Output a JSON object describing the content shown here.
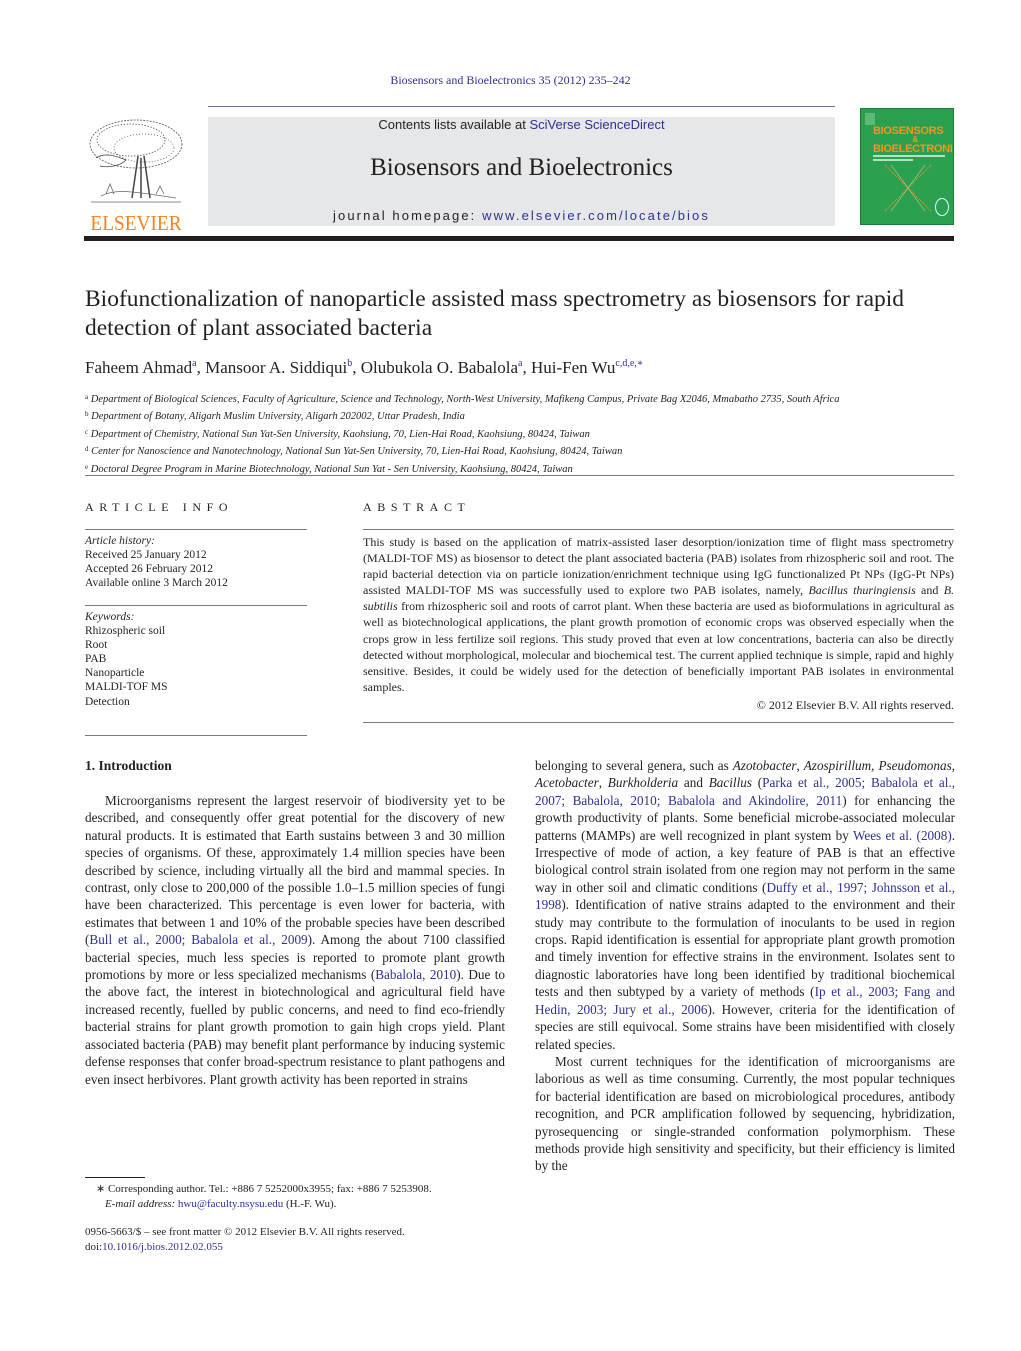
{
  "header": {
    "citation": "Biosensors and Bioelectronics 35 (2012) 235–242",
    "publisher_logo_text": "ELSEVIER",
    "contents_prefix": "Contents lists available at ",
    "contents_link": "SciVerse ScienceDirect",
    "journal_title": "Biosensors and Bioelectronics",
    "homepage_prefix": "journal homepage: ",
    "homepage_link": "www.elsevier.com/locate/bios",
    "cover_title_line1": "BIOSENSORS",
    "cover_title_amp": "&",
    "cover_title_line2": "BIOELECTRONICS"
  },
  "article": {
    "title": "Biofunctionalization of nanoparticle assisted mass spectrometry as biosensors for rapid detection of plant associated bacteria",
    "authors": [
      {
        "name": "Faheem Ahmad",
        "sup": "a"
      },
      {
        "name": "Mansoor A. Siddiqui",
        "sup": "b"
      },
      {
        "name": "Olubukola O. Babalola",
        "sup": "a"
      },
      {
        "name": "Hui-Fen Wu",
        "sup": "c,d,e,∗"
      }
    ],
    "affiliations": [
      {
        "sup": "a",
        "text": "Department of Biological Sciences, Faculty of Agriculture, Science and Technology, North-West University, Mafikeng Campus, Private Bag X2046, Mmabatho 2735, South Africa"
      },
      {
        "sup": "b",
        "text": "Department of Botany, Aligarh Muslim University, Aligarh 202002, Uttar Pradesh, India"
      },
      {
        "sup": "c",
        "text": "Department of Chemistry, National Sun Yat-Sen University, Kaohsiung, 70, Lien-Hai Road, Kaohsiung, 80424, Taiwan"
      },
      {
        "sup": "d",
        "text": "Center for Nanoscience and Nanotechnology, National Sun Yat-Sen University, 70, Lien-Hai Road, Kaohsiung, 80424, Taiwan"
      },
      {
        "sup": "e",
        "text": "Doctoral Degree Program in Marine Biotechnology, National Sun Yat - Sen University, Kaohsiung, 80424, Taiwan"
      }
    ]
  },
  "article_info": {
    "heading": "ARTICLE INFO",
    "history_label": "Article history:",
    "history": [
      "Received 25 January 2012",
      "Accepted 26 February 2012",
      "Available online 3 March 2012"
    ],
    "keywords_label": "Keywords:",
    "keywords": [
      "Rhizospheric soil",
      "Root",
      "PAB",
      "Nanoparticle",
      "MALDI-TOF MS",
      "Detection"
    ]
  },
  "abstract": {
    "heading": "ABSTRACT",
    "p1": "This study is based on the application of matrix-assisted laser desorption/ionization time of flight mass spectrometry (MALDI-TOF MS) as biosensor to detect the plant associated bacteria (PAB) isolates from rhizospheric soil and root. The rapid bacterial detection via on particle ionization/enrichment technique using IgG functionalized Pt NPs (IgG-Pt NPs) assisted MALDI-TOF MS was successfully used to explore two PAB isolates, namely, ",
    "sp1": "Bacillus thuringiensis",
    "and": " and ",
    "sp2": "B. subtilis",
    "p2": " from rhizospheric soil and roots of carrot plant. When these bacteria are used as bioformulations in agricultural as well as biotechnological applications, the plant growth promotion of economic crops was observed especially when the crops grow in less fertilize soil regions. This study proved that even at low concentrations, bacteria can also be directly detected without morphological, molecular and biochemical test. The current applied technique is simple, rapid and highly sensitive. Besides, it could be widely used for the detection of beneficially important PAB isolates in environmental samples.",
    "copyright": "© 2012 Elsevier B.V. All rights reserved."
  },
  "introduction": {
    "heading": "1.  Introduction",
    "c1_a": "Microorganisms represent the largest reservoir of biodiversity yet to be described, and consequently offer great potential for the discovery of new natural products. It is estimated that Earth sustains between 3 and 30 million species of organisms. Of these, approximately 1.4 million species have been described by science, including virtually all the bird and mammal species. In contrast, only close to 200,000 of the possible 1.0–1.5 million species of fungi have been characterized. This percentage is even lower for bacteria, with estimates that between 1 and 10% of the probable species have been described (",
    "ref1": "Bull et al., 2000; Babalola et al., 2009",
    "c1_b": "). Among the about 7100 classified bacterial species, much less species is reported to promote plant growth promotions by more or less specialized mechanisms (",
    "ref2": "Babalola, 2010",
    "c1_c": "). Due to the above fact, the interest in biotechnological and agricultural field have increased recently, fuelled by public concerns, and need to find eco-friendly bacterial strains for plant growth promotion to gain high crops yield. Plant associated bacteria (PAB) may benefit plant performance by inducing systemic defense responses that confer broad-spectrum resistance to plant pathogens and even insect herbivores. Plant growth activity has been reported in strains",
    "c2_a": "belonging to several genera, such as ",
    "g1": "Azotobacter",
    "g2": "Azospirillum",
    "g3": "Pseudomonas",
    "g4": "Acetobacter",
    "g5": "Burkholderia",
    "g6": "Bacillus",
    "ref3": "Parka et al., 2005; Babalola et al., 2007; Babalola, 2010; Babalola and Akindolire, 2011",
    "c2_b": ") for enhancing the growth productivity of plants. Some beneficial microbe-associated molecular patterns (MAMPs) are well recognized in plant system by ",
    "ref4": "Wees et al. (2008)",
    "c2_c": ". Irrespective of mode of action, a key feature of PAB is that an effective biological control strain isolated from one region may not perform in the same way in other soil and climatic conditions (",
    "ref5": "Duffy et al., 1997; Johnsson et al., 1998",
    "c2_d": "). Identification of native strains adapted to the environment and their study may contribute to the formulation of inoculants to be used in region crops. Rapid identification is essential for appropriate plant growth promotion and timely invention for effective strains in the environment. Isolates sent to diagnostic laboratories have long been identified by traditional biochemical tests and then subtyped by a variety of methods (",
    "ref6": "Ip et al., 2003; Fang and Hedin, 2003; Jury et al., 2006",
    "c2_e": "). However, criteria for the identification of species are still equivocal. Some strains have been misidentified with closely related species.",
    "c2_p2": "Most current techniques for the identification of microorganisms are laborious as well as time consuming. Currently, the most popular techniques for bacterial identification are based on microbiological procedures, antibody recognition, and PCR amplification followed by sequencing, hybridization, pyrosequencing or single-stranded conformation polymorphism. These methods provide high sensitivity and specificity, but their efficiency is limited by the"
  },
  "footnote": {
    "star": "∗",
    "corresponding": "Corresponding author. Tel.: +886 7 5252000x3955; fax: +886 7 5253908.",
    "email_label": "E-mail address: ",
    "email": "hwu@faculty.nsysu.edu",
    "email_suffix": " (H.-F. Wu).",
    "front_matter": "0956-5663/$ – see front matter © 2012 Elsevier B.V. All rights reserved.",
    "doi_prefix": "doi:",
    "doi": "10.1016/j.bios.2012.02.055"
  },
  "colors": {
    "link": "#2e3192",
    "elsevier_orange": "#f58220",
    "banner_gray": "#e6e7e8",
    "cover_green": "#2aa050"
  }
}
